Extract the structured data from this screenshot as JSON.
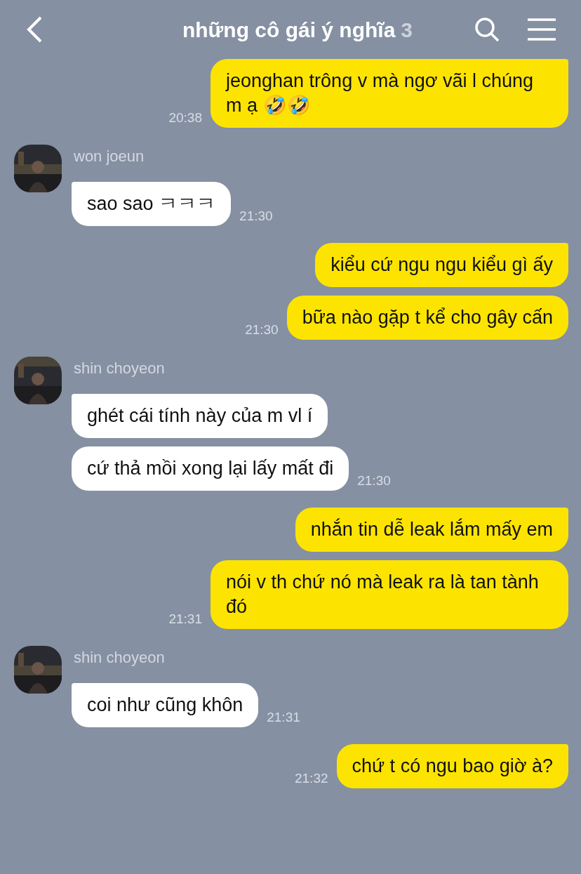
{
  "header": {
    "title": "những cô gái ý nghĩa",
    "member_count": "3"
  },
  "groups": [
    {
      "kind": "sent",
      "bubbles": [
        {
          "text": "jeonghan trông v mà ngơ vãi l chúng m ạ 🤣🤣",
          "time": "20:38"
        }
      ]
    },
    {
      "kind": "received",
      "sender": "won joeun",
      "bubbles": [
        {
          "text": "sao sao ㅋㅋㅋ",
          "time": "21:30"
        }
      ]
    },
    {
      "kind": "sent",
      "bubbles": [
        {
          "text": "kiểu cứ ngu ngu kiểu gì ấy"
        },
        {
          "text": "bữa nào gặp t kể cho gây cấn",
          "time": "21:30"
        }
      ]
    },
    {
      "kind": "received",
      "sender": "shin choyeon",
      "bubbles": [
        {
          "text": "ghét cái tính này của m vl í"
        },
        {
          "text": "cứ thả mồi xong lại lấy mất đi",
          "time": "21:30"
        }
      ]
    },
    {
      "kind": "sent",
      "bubbles": [
        {
          "text": "nhắn tin dễ leak lắm mấy em"
        },
        {
          "text": "nói v th chứ nó mà leak ra là tan tành đó",
          "time": "21:31"
        }
      ]
    },
    {
      "kind": "received",
      "sender": "shin choyeon",
      "bubbles": [
        {
          "text": "coi như cũng khôn",
          "time": "21:31"
        }
      ]
    },
    {
      "kind": "sent",
      "bubbles": [
        {
          "text": "chứ t có ngu bao giờ à?",
          "time": "21:32"
        }
      ]
    }
  ]
}
